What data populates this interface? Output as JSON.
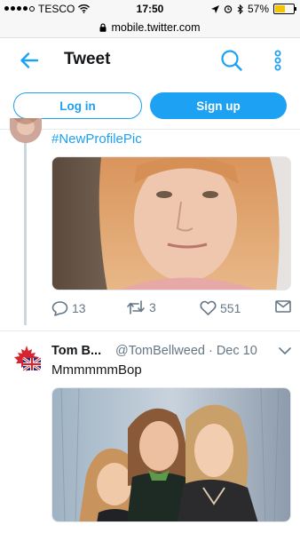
{
  "status_bar": {
    "carrier": "TESCO",
    "time": "17:50",
    "battery_percent": "57%",
    "battery_level": 0.57
  },
  "url_bar": {
    "url": "mobile.twitter.com"
  },
  "header": {
    "title": "Tweet"
  },
  "auth": {
    "login_label": "Log in",
    "signup_label": "Sign up"
  },
  "tweets": [
    {
      "text": "#NewProfilePic",
      "replies": "13",
      "retweets": "3",
      "likes": "551"
    },
    {
      "name": "Tom B...",
      "handle_date": "@TomBellweed · Dec 10",
      "text": "MmmmmmBop"
    }
  ],
  "colors": {
    "accent": "#1da1f2",
    "muted": "#657786",
    "border": "#e6ecf0"
  }
}
